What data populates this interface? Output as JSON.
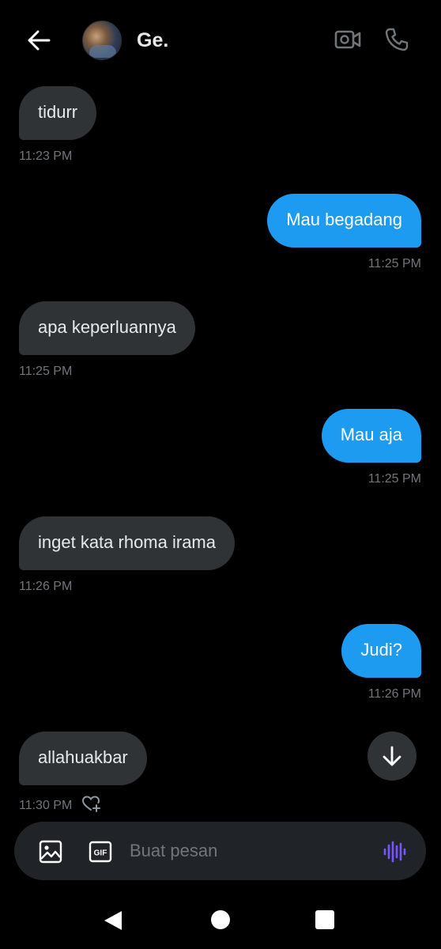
{
  "header": {
    "contact_name": "Ge.",
    "icons": {
      "back": "arrow-left-icon",
      "video": "video-camera-icon",
      "call": "phone-icon"
    }
  },
  "messages": [
    {
      "direction": "received",
      "text": "tidurr",
      "time": "11:23 PM"
    },
    {
      "direction": "sent",
      "text": "Mau begadang",
      "time": "11:25 PM"
    },
    {
      "direction": "received",
      "text": "apa keperluannya",
      "time": "11:25 PM"
    },
    {
      "direction": "sent",
      "text": "Mau aja",
      "time": "11:25 PM"
    },
    {
      "direction": "received",
      "text": "inget kata rhoma irama",
      "time": "11:26 PM"
    },
    {
      "direction": "sent",
      "text": "Judi?",
      "time": "11:26 PM"
    },
    {
      "direction": "received",
      "text": "allahuakbar",
      "time": "11:30 PM",
      "reaction_icon": "heart-plus-icon"
    }
  ],
  "composer": {
    "placeholder": "Buat pesan",
    "value": "",
    "gif_label": "GIF",
    "icons": {
      "media": "image-icon",
      "gif": "gif-icon",
      "voice": "voice-waveform-icon"
    }
  },
  "colors": {
    "background": "#000000",
    "received_bubble": "#2f3336",
    "sent_bubble": "#1d9bf0",
    "timestamp": "#71767b",
    "voice_accent": "#7856ff"
  }
}
